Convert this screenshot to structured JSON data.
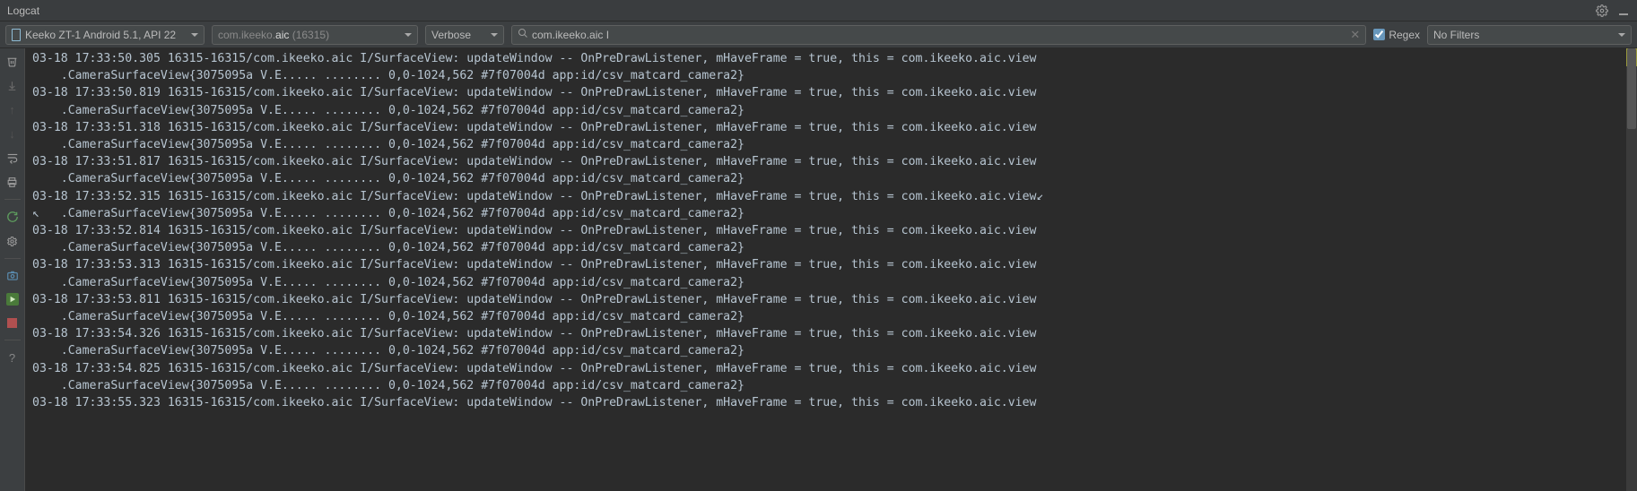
{
  "header": {
    "title": "Logcat"
  },
  "toolbar": {
    "device_label": "Keeko ZT-1 Android 5.1, API 22",
    "package_prefix": "com.ikeeko.",
    "package_strong": "aic",
    "package_suffix": " (16315)",
    "log_level": "Verbose",
    "search_value": "com.ikeeko.aic I",
    "regex_label": "Regex",
    "regex_checked": true,
    "filter_label": "No Filters"
  },
  "log_lines": [
    "03-18 17:33:50.305 16315-16315/com.ikeeko.aic I/SurfaceView: updateWindow -- OnPreDrawListener, mHaveFrame = true, this = com.ikeeko.aic.view",
    "    .CameraSurfaceView{3075095a V.E..... ........ 0,0-1024,562 #7f07004d app:id/csv_matcard_camera2}",
    "03-18 17:33:50.819 16315-16315/com.ikeeko.aic I/SurfaceView: updateWindow -- OnPreDrawListener, mHaveFrame = true, this = com.ikeeko.aic.view",
    "    .CameraSurfaceView{3075095a V.E..... ........ 0,0-1024,562 #7f07004d app:id/csv_matcard_camera2}",
    "03-18 17:33:51.318 16315-16315/com.ikeeko.aic I/SurfaceView: updateWindow -- OnPreDrawListener, mHaveFrame = true, this = com.ikeeko.aic.view",
    "    .CameraSurfaceView{3075095a V.E..... ........ 0,0-1024,562 #7f07004d app:id/csv_matcard_camera2}",
    "03-18 17:33:51.817 16315-16315/com.ikeeko.aic I/SurfaceView: updateWindow -- OnPreDrawListener, mHaveFrame = true, this = com.ikeeko.aic.view",
    "    .CameraSurfaceView{3075095a V.E..... ........ 0,0-1024,562 #7f07004d app:id/csv_matcard_camera2}",
    "03-18 17:33:52.315 16315-16315/com.ikeeko.aic I/SurfaceView: updateWindow -- OnPreDrawListener, mHaveFrame = true, this = com.ikeeko.aic.view↙",
    "↖   .CameraSurfaceView{3075095a V.E..... ........ 0,0-1024,562 #7f07004d app:id/csv_matcard_camera2}",
    "03-18 17:33:52.814 16315-16315/com.ikeeko.aic I/SurfaceView: updateWindow -- OnPreDrawListener, mHaveFrame = true, this = com.ikeeko.aic.view",
    "    .CameraSurfaceView{3075095a V.E..... ........ 0,0-1024,562 #7f07004d app:id/csv_matcard_camera2}",
    "03-18 17:33:53.313 16315-16315/com.ikeeko.aic I/SurfaceView: updateWindow -- OnPreDrawListener, mHaveFrame = true, this = com.ikeeko.aic.view",
    "    .CameraSurfaceView{3075095a V.E..... ........ 0,0-1024,562 #7f07004d app:id/csv_matcard_camera2}",
    "03-18 17:33:53.811 16315-16315/com.ikeeko.aic I/SurfaceView: updateWindow -- OnPreDrawListener, mHaveFrame = true, this = com.ikeeko.aic.view",
    "    .CameraSurfaceView{3075095a V.E..... ........ 0,0-1024,562 #7f07004d app:id/csv_matcard_camera2}",
    "03-18 17:33:54.326 16315-16315/com.ikeeko.aic I/SurfaceView: updateWindow -- OnPreDrawListener, mHaveFrame = true, this = com.ikeeko.aic.view",
    "    .CameraSurfaceView{3075095a V.E..... ........ 0,0-1024,562 #7f07004d app:id/csv_matcard_camera2}",
    "03-18 17:33:54.825 16315-16315/com.ikeeko.aic I/SurfaceView: updateWindow -- OnPreDrawListener, mHaveFrame = true, this = com.ikeeko.aic.view",
    "    .CameraSurfaceView{3075095a V.E..... ........ 0,0-1024,562 #7f07004d app:id/csv_matcard_camera2}",
    "03-18 17:33:55.323 16315-16315/com.ikeeko.aic I/SurfaceView: updateWindow -- OnPreDrawListener, mHaveFrame = true, this = com.ikeeko.aic.view"
  ]
}
